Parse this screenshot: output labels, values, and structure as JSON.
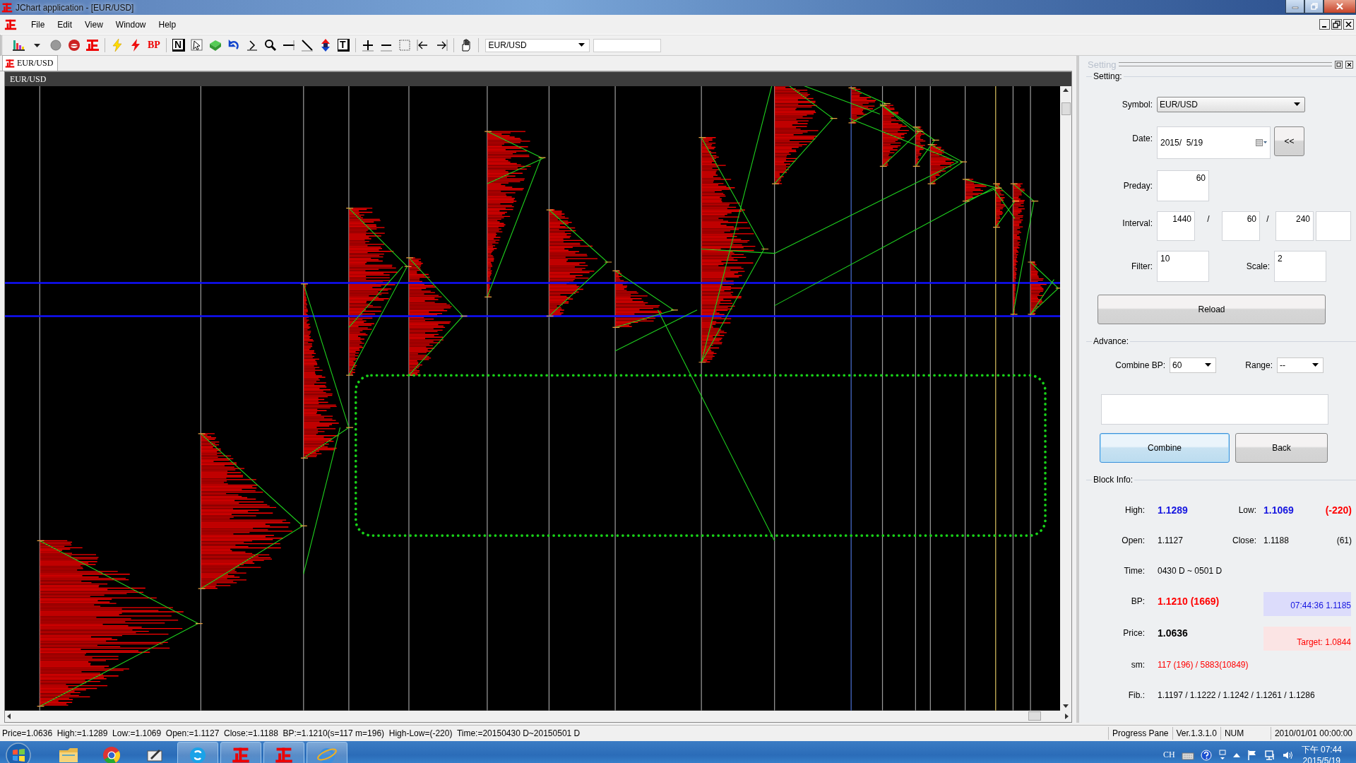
{
  "window": {
    "title": "JChart application - [EUR/USD]"
  },
  "menu": [
    "File",
    "Edit",
    "View",
    "Window",
    "Help"
  ],
  "toolbar": {
    "labels": [
      "BP",
      "N",
      "T"
    ],
    "symbol": "EUR/USD"
  },
  "tabs": [
    {
      "label": "EUR/USD",
      "selected": true
    }
  ],
  "chart": {
    "title": "EUR/USD"
  },
  "setting": {
    "title": "Setting",
    "group": "Setting:",
    "symbol_label": "Symbol:",
    "symbol": "EUR/USD",
    "date_label": "Date:",
    "date": "2015/  5/19",
    "back_button": "<<",
    "preday_label": "Preday:",
    "preday": "60",
    "interval_label": "Interval:",
    "intervals": [
      "1440",
      "60",
      "240"
    ],
    "interval_separators": [
      "/",
      "/"
    ],
    "filter_label": "Filter:",
    "filter": "10",
    "scale_label": "Scale:",
    "scale": "2",
    "reload_button": "Reload"
  },
  "advance": {
    "group": "Advance:",
    "combine_bp_label": "Combine BP:",
    "combine_bp": "60",
    "range_label": "Range:",
    "range": "--",
    "buttons": [
      {
        "label": "Combine",
        "focused": true
      },
      {
        "label": "Back",
        "focused": false
      }
    ]
  },
  "block_info": {
    "group": "Block Info:",
    "high_label": "High:",
    "high": "1.1289",
    "low_label": "Low:",
    "low": "1.1069",
    "range": "(-220)",
    "open_label": "Open:",
    "open": "1.1127",
    "close_label": "Close:",
    "close": "1.1188",
    "change": "(61)",
    "time_label": "Time:",
    "time": "0430 D ~ 0501 D",
    "bp_label": "BP:",
    "bp": "1.1210 (1669)",
    "live": "07:44:36  1.1185",
    "price_label": "Price:",
    "price": "1.0636",
    "target": "Target: 1.0844",
    "sm_label": "sm:",
    "sm": "117 (196) / 5883(10849)",
    "fib_label": "Fib.:",
    "fib": "1.1197 / 1.1222 / 1.1242 / 1.1261 / 1.1286"
  },
  "status_bar": {
    "message": "Price=1.0636  High:=1.1289  Low:=1.1069  Open:=1.1127  Close:=1.1188  BP:=1.1210(s=117 m=196)  High-Low=(-220)  Time:=20150430 D~20150501 D",
    "panes": [
      "Progress Pane",
      "Ver.1.3.1.0",
      "NUM",
      "2010/01/01 00:00:00"
    ]
  },
  "taskbar": {
    "apps": [
      {
        "kind": "folder",
        "running": false
      },
      {
        "kind": "wheel",
        "running": false
      },
      {
        "kind": "pen",
        "running": false
      },
      {
        "kind": "bubble",
        "running": true
      },
      {
        "kind": "logo",
        "running": true
      },
      {
        "kind": "logo",
        "running": true
      },
      {
        "kind": "orbit",
        "running": true
      }
    ],
    "language": "CH",
    "time": "下午 07:44",
    "date": "2015/5/19"
  }
}
